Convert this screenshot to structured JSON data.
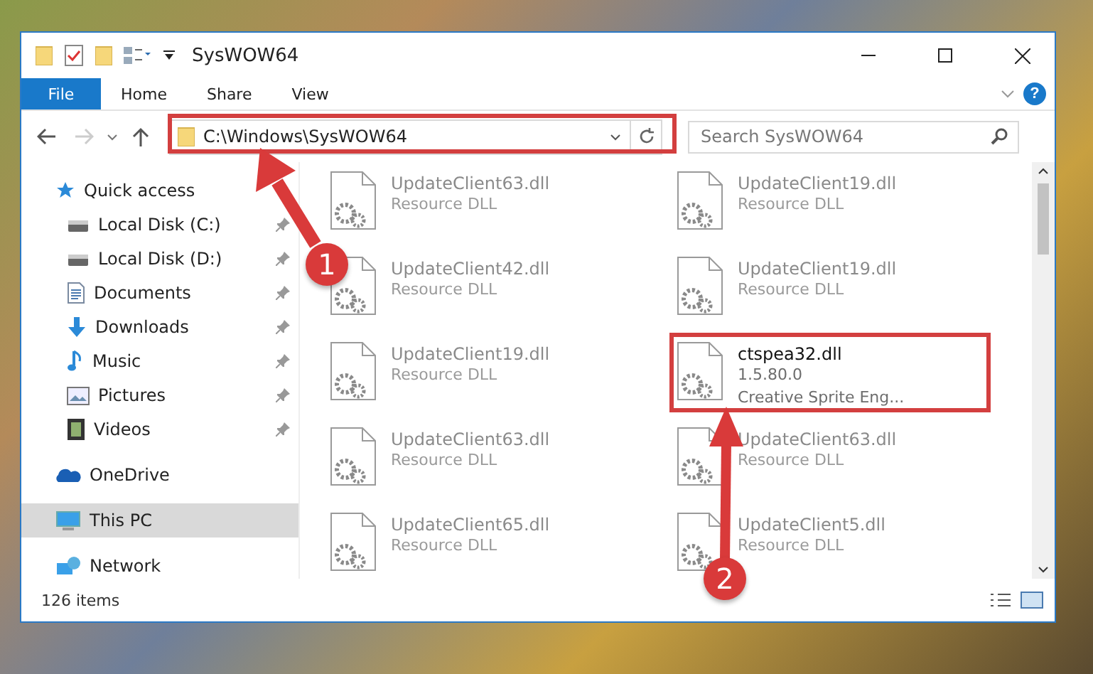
{
  "window": {
    "title": "SysWOW64"
  },
  "ribbon": {
    "tabs": [
      {
        "label": "File",
        "kind": "file"
      },
      {
        "label": "Home",
        "kind": "tab"
      },
      {
        "label": "Share",
        "kind": "tab"
      },
      {
        "label": "View",
        "kind": "tab"
      }
    ],
    "help": "?"
  },
  "navigation": {
    "forward_disabled": true,
    "address": "C:\\Windows\\SysWOW64",
    "search": {
      "placeholder": "Search SysWOW64"
    }
  },
  "sidebar": {
    "items": [
      {
        "label": "Quick access",
        "kind": "quick",
        "selected": false,
        "children": [
          {
            "label": "Local Disk (C:)",
            "kind": "disk",
            "selected": false,
            "pinned": true
          },
          {
            "label": "Local Disk (D:)",
            "kind": "disk",
            "selected": false,
            "pinned": true
          },
          {
            "label": "Documents",
            "kind": "documents",
            "selected": false,
            "pinned": true
          },
          {
            "label": "Downloads",
            "kind": "downloads",
            "selected": false,
            "pinned": true
          },
          {
            "label": "Music",
            "kind": "music",
            "selected": false,
            "pinned": true
          },
          {
            "label": "Pictures",
            "kind": "pictures",
            "selected": false,
            "pinned": true
          },
          {
            "label": "Videos",
            "kind": "videos",
            "selected": false,
            "pinned": true
          }
        ]
      },
      {
        "label": "OneDrive",
        "kind": "cloud",
        "selected": false
      },
      {
        "label": "This PC",
        "kind": "pc",
        "selected": true
      },
      {
        "label": "Network",
        "kind": "network",
        "selected": false
      }
    ]
  },
  "files": [
    {
      "name": "UpdateClient63.dll",
      "lines": [
        "Resource DLL"
      ],
      "faded": true,
      "highlighted": false
    },
    {
      "name": "UpdateClient19.dll",
      "lines": [
        "Resource DLL"
      ],
      "faded": true,
      "highlighted": false
    },
    {
      "name": "UpdateClient42.dll",
      "lines": [
        "Resource DLL"
      ],
      "faded": true,
      "highlighted": false
    },
    {
      "name": "UpdateClient19.dll",
      "lines": [
        "Resource DLL"
      ],
      "faded": true,
      "highlighted": false
    },
    {
      "name": "UpdateClient19.dll",
      "lines": [
        "Resource DLL"
      ],
      "faded": true,
      "highlighted": false
    },
    {
      "name": "ctspea32.dll",
      "lines": [
        "1.5.80.0",
        "Creative Sprite Eng..."
      ],
      "faded": false,
      "highlighted": true
    },
    {
      "name": "UpdateClient63.dll",
      "lines": [
        "Resource DLL"
      ],
      "faded": true,
      "highlighted": false
    },
    {
      "name": "UpdateClient63.dll",
      "lines": [
        "Resource DLL"
      ],
      "faded": true,
      "highlighted": false
    },
    {
      "name": "UpdateClient65.dll",
      "lines": [
        "Resource DLL"
      ],
      "faded": true,
      "highlighted": false
    },
    {
      "name": "UpdateClient5.dll",
      "lines": [
        "Resource DLL"
      ],
      "faded": true,
      "highlighted": false
    }
  ],
  "status_bar": {
    "count": "126 items"
  },
  "annotations": [
    {
      "label": "1"
    },
    {
      "label": "2"
    }
  ]
}
